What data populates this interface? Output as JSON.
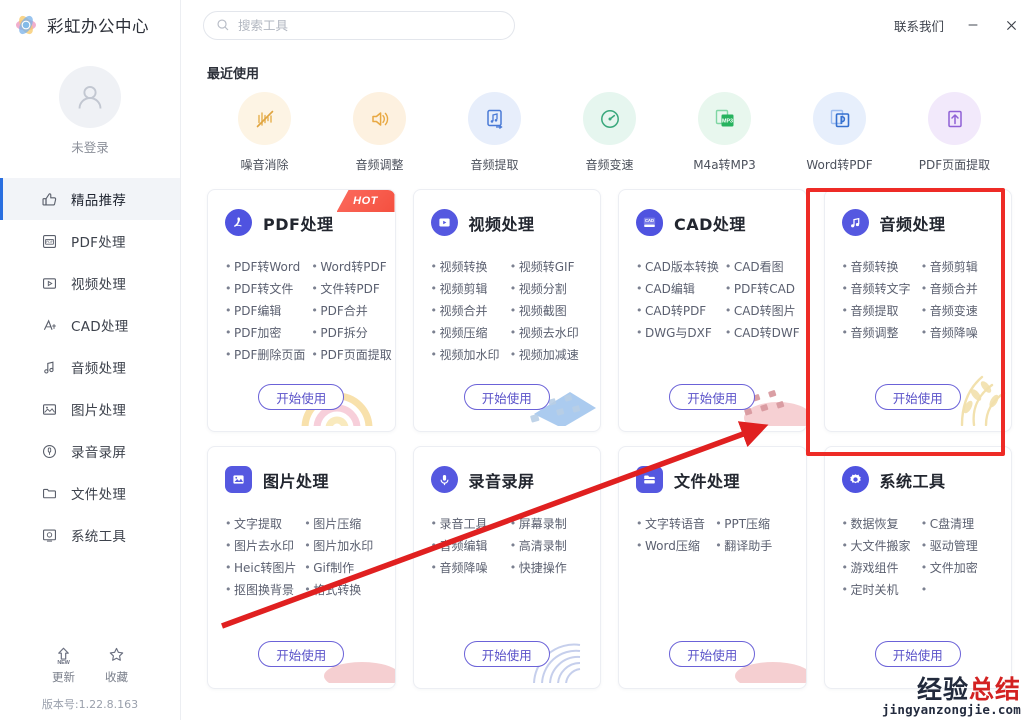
{
  "app": {
    "title": "彩虹办公中心",
    "version_label": "版本号:1.22.8.163"
  },
  "titlebar": {
    "contact": "联系我们",
    "minimize_icon": "minimize-icon",
    "close_icon": "close-icon"
  },
  "search": {
    "placeholder": "搜索工具",
    "value": "",
    "icon": "search-icon"
  },
  "sidebar": {
    "account": {
      "avatar_icon": "user-avatar-icon",
      "status": "未登录"
    },
    "items": [
      {
        "label": "精品推荐",
        "icon": "thumbs-up-icon",
        "active": true
      },
      {
        "label": "PDF处理",
        "icon": "pdf-file-icon",
        "active": false
      },
      {
        "label": "视频处理",
        "icon": "video-play-icon",
        "active": false
      },
      {
        "label": "CAD处理",
        "icon": "cad-ruler-icon",
        "active": false
      },
      {
        "label": "音频处理",
        "icon": "music-note-icon",
        "active": false
      },
      {
        "label": "图片处理",
        "icon": "image-picture-icon",
        "active": false
      },
      {
        "label": "录音录屏",
        "icon": "microphone-icon",
        "active": false
      },
      {
        "label": "文件处理",
        "icon": "folder-icon",
        "active": false
      },
      {
        "label": "系统工具",
        "icon": "system-gear-icon",
        "active": false
      }
    ],
    "actions": [
      {
        "label": "更新",
        "icon": "update-arrow-new-icon",
        "badge": "NEW"
      },
      {
        "label": "收藏",
        "icon": "star-icon",
        "badge": ""
      }
    ]
  },
  "main": {
    "recent_title": "最近使用",
    "recent": [
      {
        "label": "噪音消除",
        "icon": "noise-remove-icon",
        "bg": "#fdf4e4",
        "fg": "#e8b356"
      },
      {
        "label": "音频调整",
        "icon": "speaker-volume-icon",
        "bg": "#fdf1e0",
        "fg": "#e8a842"
      },
      {
        "label": "音频提取",
        "icon": "audio-extract-icon",
        "bg": "#e7eefb",
        "fg": "#4a7ad6"
      },
      {
        "label": "音频变速",
        "icon": "audio-speed-icon",
        "bg": "#e6f6ef",
        "fg": "#39a87c"
      },
      {
        "label": "M4a转MP3",
        "icon": "mp3-convert-icon",
        "bg": "#e8f7ee",
        "fg": "#26b35e"
      },
      {
        "label": "Word转PDF",
        "icon": "word-to-pdf-icon",
        "bg": "#e7effc",
        "fg": "#3570cf"
      },
      {
        "label": "PDF页面提取",
        "icon": "pdf-page-extract-icon",
        "bg": "#f2e9fb",
        "fg": "#9061d6"
      }
    ],
    "start_button": "开始使用",
    "hot_badge": "HOT",
    "cards": [
      {
        "title": "PDF处理",
        "icon": "pdf-acrobat-icon",
        "hot": true,
        "highlighted": false,
        "deco": "rainbow-arcs",
        "items_left": [
          "PDF转Word",
          "PDF转文件",
          "PDF编辑",
          "PDF加密",
          "PDF删除页面"
        ],
        "items_right": [
          "Word转PDF",
          "文件转PDF",
          "PDF合并",
          "PDF拆分",
          "PDF页面提取"
        ]
      },
      {
        "title": "视频处理",
        "icon": "video-play-circle-icon",
        "hot": false,
        "highlighted": false,
        "deco": "blue-film-shards",
        "items_left": [
          "视频转换",
          "视频剪辑",
          "视频合并",
          "视频压缩",
          "视频加水印"
        ],
        "items_right": [
          "视频转GIF",
          "视频分割",
          "视频截图",
          "视频去水印",
          "视频加减速"
        ]
      },
      {
        "title": "CAD处理",
        "icon": "cad-badge-icon",
        "hot": false,
        "highlighted": false,
        "deco": "pink-shards",
        "items_left": [
          "CAD版本转换",
          "CAD编辑",
          "CAD转PDF",
          "DWG与DXF"
        ],
        "items_right": [
          "CAD看图",
          "PDF转CAD",
          "CAD转图片",
          "CAD转DWF"
        ]
      },
      {
        "title": "音频处理",
        "icon": "music-note-circle-icon",
        "hot": false,
        "highlighted": true,
        "deco": "yellow-wheat",
        "items_left": [
          "音频转换",
          "音频转文字",
          "音频提取",
          "音频调整"
        ],
        "items_right": [
          "音频剪辑",
          "音频合并",
          "音频变速",
          "音频降噪"
        ]
      },
      {
        "title": "图片处理",
        "icon": "picture-circle-icon",
        "hot": false,
        "highlighted": false,
        "deco": "pink-blob",
        "items_left": [
          "文字提取",
          "图片去水印",
          "Heic转图片",
          "抠图换背景"
        ],
        "items_right": [
          "图片压缩",
          "图片加水印",
          "Gif制作",
          "格式转换"
        ]
      },
      {
        "title": "录音录屏",
        "icon": "microphone-circle-icon",
        "hot": false,
        "highlighted": false,
        "deco": "blue-arcs",
        "items_left": [
          "录音工具",
          "音频编辑",
          "音频降噪"
        ],
        "items_right": [
          "屏幕录制",
          "高清录制",
          "快捷操作"
        ]
      },
      {
        "title": "文件处理",
        "icon": "folder-circle-icon",
        "hot": false,
        "highlighted": false,
        "deco": "pink-blob",
        "items_left": [
          "文字转语音",
          "Word压缩"
        ],
        "items_right": [
          "PPT压缩",
          "翻译助手"
        ]
      },
      {
        "title": "系统工具",
        "icon": "gear-circle-icon",
        "hot": false,
        "highlighted": false,
        "deco": "none",
        "items_left": [
          "数据恢复",
          "大文件搬家",
          "游戏组件",
          "定时关机"
        ],
        "items_right": [
          "C盘清理",
          "驱动管理",
          "文件加密"
        ]
      }
    ]
  },
  "annotations": {
    "highlight_color": "#ee2b26",
    "arrow_color": "#e02020",
    "highlight_target": "音频处理"
  },
  "watermark": {
    "text_dark": "经验",
    "text_red": "总结",
    "url": "jingyanzongjie.com"
  }
}
